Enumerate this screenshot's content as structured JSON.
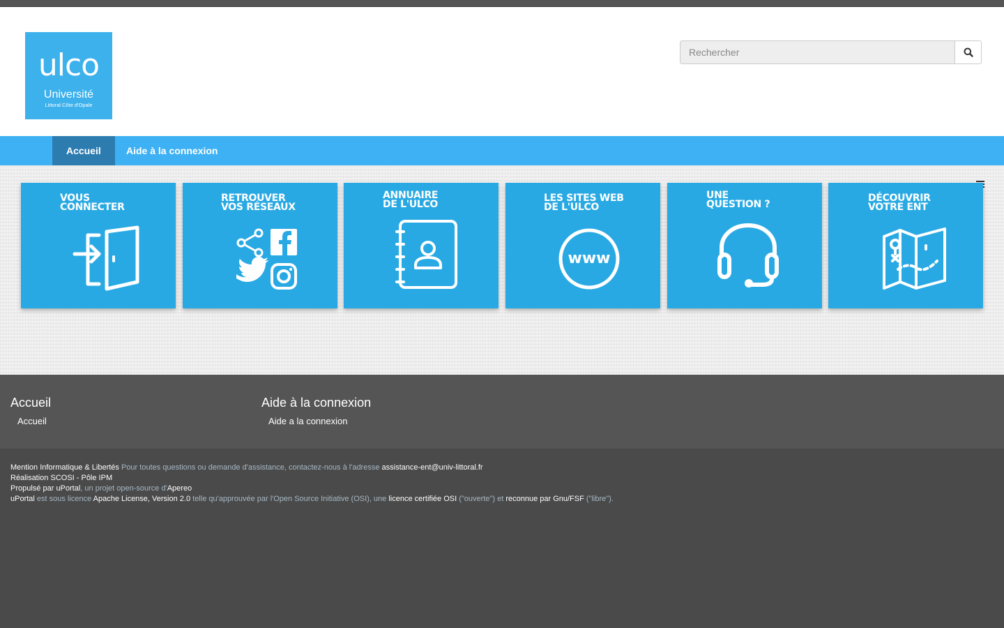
{
  "logo": {
    "name": "ulco",
    "university": "Université",
    "subtitle": "Littoral Côte d'Opale"
  },
  "search": {
    "placeholder": "Rechercher"
  },
  "nav": {
    "items": [
      {
        "label": "Accueil"
      },
      {
        "label": "Aide à la connexion"
      }
    ]
  },
  "tiles": [
    {
      "title": "VOUS\nCONNECTER",
      "icon": "door-enter-icon"
    },
    {
      "title": "RETROUVER\nVOS RÉSEAUX",
      "icon": "social-networks-icon"
    },
    {
      "title": "ANNUAIRE\nDE L'ULCO",
      "icon": "address-book-icon"
    },
    {
      "title": "LES SITES WEB\nDE L'ULCO",
      "icon": "www-icon"
    },
    {
      "title": "UNE\nQUESTION ?",
      "icon": "headset-icon"
    },
    {
      "title": "DÉCOUVRIR\nVOTRE ENT",
      "icon": "map-icon"
    }
  ],
  "www_text": "www",
  "footer_nav": [
    {
      "title": "Accueil",
      "link": "Accueil"
    },
    {
      "title": "Aide à la connexion",
      "link": "Aide a la connexion"
    }
  ],
  "legal": {
    "line1": {
      "mention": "Mention Informatique & Libertés",
      "text": " Pour toutes questions ou demande d'assistance, contactez-nous à l'adresse ",
      "email": "assistance-ent@univ-littoral.fr"
    },
    "line2": {
      "text": "Réalisation SCOSI - Pôle IPM"
    },
    "line3": {
      "prefix": "Propulsé par ",
      "uportal": "uPortal",
      "middle": ", un projet open-source d'",
      "apereo": "Apereo"
    },
    "line4": {
      "uportal": "uPortal",
      "t1": " est sous licence ",
      "license": "Apache License, Version 2.0",
      "t2": " telle qu'approuvée par l'Open Source Initiative (OSI), une ",
      "osi": "licence certifiée OSI",
      "t3": " (\"ouverte\") et ",
      "gnu": "reconnue par Gnu/FSF",
      "t4": " (\"libre\")."
    }
  }
}
